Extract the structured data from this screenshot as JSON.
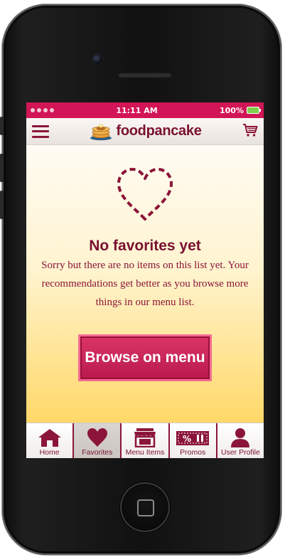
{
  "status_bar": {
    "time": "11:11 AM",
    "battery": "100%"
  },
  "header": {
    "logo_text": "foodpancake"
  },
  "empty_state": {
    "title": "No favorites yet",
    "description": "Sorry but there are no items on this list yet. Your recommendations get better as you browse more things in our menu list.",
    "button_label": "Browse on menu"
  },
  "tabs": [
    {
      "label": "Home",
      "icon": "home-icon"
    },
    {
      "label": "Favorites",
      "icon": "heart-icon",
      "active": true
    },
    {
      "label": "Menu Items",
      "icon": "storefront-icon"
    },
    {
      "label": "Promos",
      "icon": "coupon-icon"
    },
    {
      "label": "User Profile",
      "icon": "user-icon"
    }
  ],
  "colors": {
    "accent": "#d21556",
    "brand_text": "#7a1030",
    "gradient_bottom": "#ffd868"
  }
}
